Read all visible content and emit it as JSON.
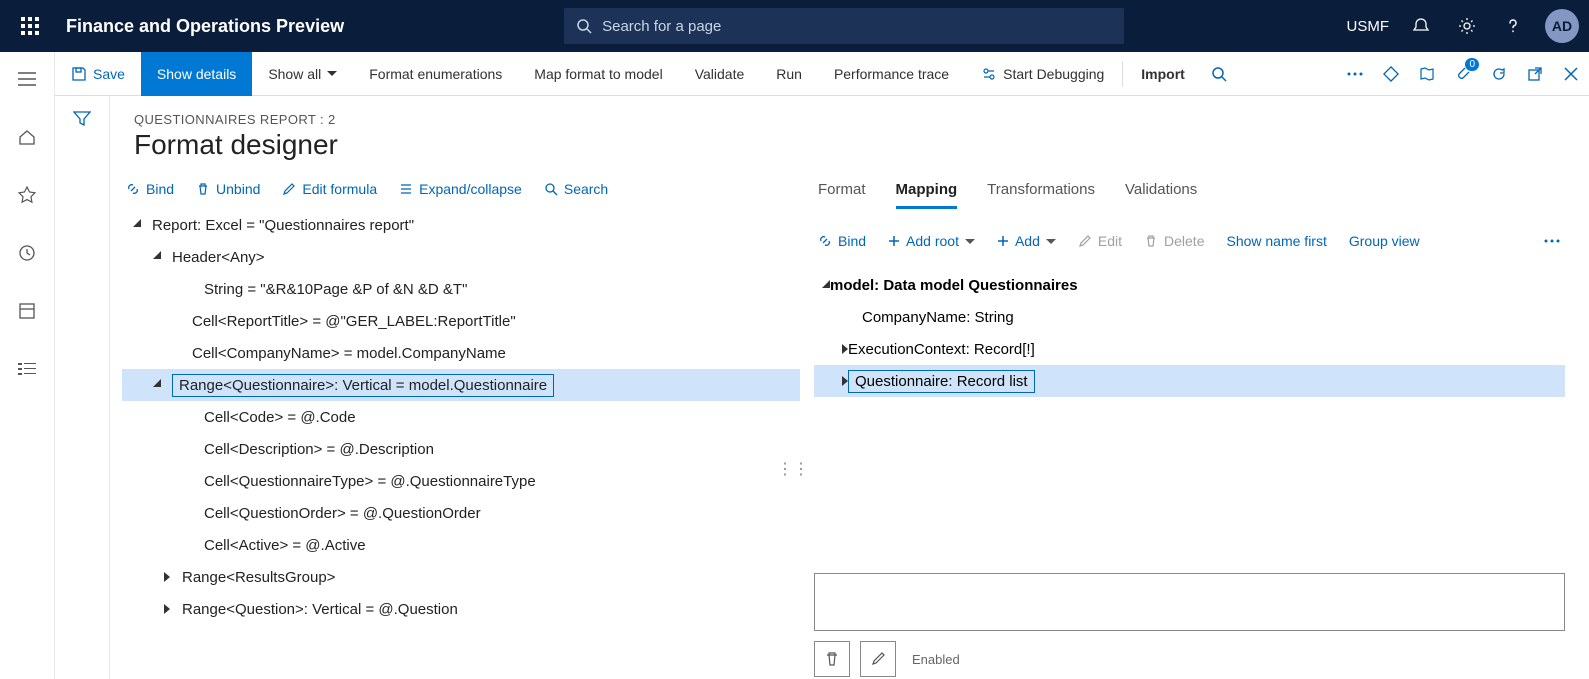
{
  "topbar": {
    "app_title": "Finance and Operations Preview",
    "search_placeholder": "Search for a page",
    "company": "USMF",
    "avatar_initials": "AD"
  },
  "actionbar": {
    "save": "Save",
    "show_details": "Show details",
    "show_all": "Show all",
    "format_enumerations": "Format enumerations",
    "map_format": "Map format to model",
    "validate": "Validate",
    "run": "Run",
    "performance_trace": "Performance trace",
    "start_debugging": "Start Debugging",
    "import": "Import",
    "badge_count": "0"
  },
  "header": {
    "breadcrumb": "QUESTIONNAIRES REPORT : 2",
    "page_title": "Format designer"
  },
  "left_toolbar": {
    "bind": "Bind",
    "unbind": "Unbind",
    "edit_formula": "Edit formula",
    "expand_collapse": "Expand/collapse",
    "search": "Search"
  },
  "left_tree": {
    "n0": "Report: Excel = \"Questionnaires report\"",
    "n1": "Header<Any>",
    "n2": "String = \"&R&10Page &P of &N &D &T\"",
    "n3": "Cell<ReportTitle> = @\"GER_LABEL:ReportTitle\"",
    "n4": "Cell<CompanyName> = model.CompanyName",
    "n5": "Range<Questionnaire>: Vertical = model.Questionnaire",
    "n6": "Cell<Code> = @.Code",
    "n7": "Cell<Description> = @.Description",
    "n8": "Cell<QuestionnaireType> = @.QuestionnaireType",
    "n9": "Cell<QuestionOrder> = @.QuestionOrder",
    "n10": "Cell<Active> = @.Active",
    "n11": "Range<ResultsGroup>",
    "n12": "Range<Question>: Vertical = @.Question"
  },
  "right_tabs": {
    "format": "Format",
    "mapping": "Mapping",
    "transformations": "Transformations",
    "validations": "Validations"
  },
  "right_toolbar": {
    "bind": "Bind",
    "add_root": "Add root",
    "add": "Add",
    "edit": "Edit",
    "delete": "Delete",
    "show_name_first": "Show name first",
    "group_view": "Group view"
  },
  "right_tree": {
    "r0": "model: Data model Questionnaires",
    "r1": "CompanyName: String",
    "r2": "ExecutionContext: Record[!]",
    "r3": "Questionnaire: Record list"
  },
  "details": {
    "enabled_label": "Enabled"
  }
}
